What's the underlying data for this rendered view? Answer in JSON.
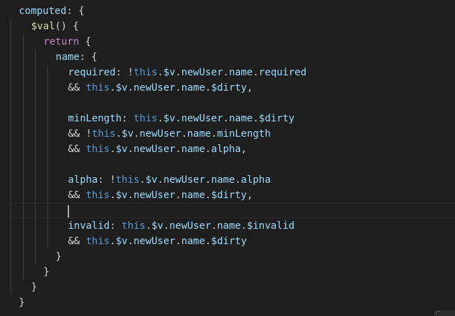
{
  "editor": {
    "lines": [
      [
        {
          "t": "computed",
          "c": "prop"
        },
        {
          "t": ": {",
          "c": "punc"
        }
      ],
      [
        {
          "t": "$val",
          "c": "func"
        },
        {
          "t": "() {",
          "c": "punc"
        }
      ],
      [
        {
          "t": "return",
          "c": "kw"
        },
        {
          "t": " {",
          "c": "punc"
        }
      ],
      [
        {
          "t": "name",
          "c": "prop"
        },
        {
          "t": ": {",
          "c": "punc"
        }
      ],
      [
        {
          "t": "required",
          "c": "prop"
        },
        {
          "t": ": !",
          "c": "punc"
        },
        {
          "t": "this",
          "c": "this"
        },
        {
          "t": ".",
          "c": "punc"
        },
        {
          "t": "$v",
          "c": "prop"
        },
        {
          "t": ".",
          "c": "punc"
        },
        {
          "t": "newUser",
          "c": "prop"
        },
        {
          "t": ".",
          "c": "punc"
        },
        {
          "t": "name",
          "c": "prop"
        },
        {
          "t": ".",
          "c": "punc"
        },
        {
          "t": "required",
          "c": "prop"
        }
      ],
      [
        {
          "t": "&& ",
          "c": "punc"
        },
        {
          "t": "this",
          "c": "this"
        },
        {
          "t": ".",
          "c": "punc"
        },
        {
          "t": "$v",
          "c": "prop"
        },
        {
          "t": ".",
          "c": "punc"
        },
        {
          "t": "newUser",
          "c": "prop"
        },
        {
          "t": ".",
          "c": "punc"
        },
        {
          "t": "name",
          "c": "prop"
        },
        {
          "t": ".",
          "c": "punc"
        },
        {
          "t": "$dirty",
          "c": "prop"
        },
        {
          "t": ",",
          "c": "punc"
        }
      ],
      [],
      [
        {
          "t": "minLength",
          "c": "prop"
        },
        {
          "t": ": ",
          "c": "punc"
        },
        {
          "t": "this",
          "c": "this"
        },
        {
          "t": ".",
          "c": "punc"
        },
        {
          "t": "$v",
          "c": "prop"
        },
        {
          "t": ".",
          "c": "punc"
        },
        {
          "t": "newUser",
          "c": "prop"
        },
        {
          "t": ".",
          "c": "punc"
        },
        {
          "t": "name",
          "c": "prop"
        },
        {
          "t": ".",
          "c": "punc"
        },
        {
          "t": "$dirty",
          "c": "prop"
        }
      ],
      [
        {
          "t": "&& !",
          "c": "punc"
        },
        {
          "t": "this",
          "c": "this"
        },
        {
          "t": ".",
          "c": "punc"
        },
        {
          "t": "$v",
          "c": "prop"
        },
        {
          "t": ".",
          "c": "punc"
        },
        {
          "t": "newUser",
          "c": "prop"
        },
        {
          "t": ".",
          "c": "punc"
        },
        {
          "t": "name",
          "c": "prop"
        },
        {
          "t": ".",
          "c": "punc"
        },
        {
          "t": "minLength",
          "c": "prop"
        }
      ],
      [
        {
          "t": "&& ",
          "c": "punc"
        },
        {
          "t": "this",
          "c": "this"
        },
        {
          "t": ".",
          "c": "punc"
        },
        {
          "t": "$v",
          "c": "prop"
        },
        {
          "t": ".",
          "c": "punc"
        },
        {
          "t": "newUser",
          "c": "prop"
        },
        {
          "t": ".",
          "c": "punc"
        },
        {
          "t": "name",
          "c": "prop"
        },
        {
          "t": ".",
          "c": "punc"
        },
        {
          "t": "alpha",
          "c": "prop"
        },
        {
          "t": ",",
          "c": "punc"
        }
      ],
      [],
      [
        {
          "t": "alpha",
          "c": "prop"
        },
        {
          "t": ": !",
          "c": "punc"
        },
        {
          "t": "this",
          "c": "this"
        },
        {
          "t": ".",
          "c": "punc"
        },
        {
          "t": "$v",
          "c": "prop"
        },
        {
          "t": ".",
          "c": "punc"
        },
        {
          "t": "newUser",
          "c": "prop"
        },
        {
          "t": ".",
          "c": "punc"
        },
        {
          "t": "name",
          "c": "prop"
        },
        {
          "t": ".",
          "c": "punc"
        },
        {
          "t": "alpha",
          "c": "prop"
        }
      ],
      [
        {
          "t": "&& ",
          "c": "punc"
        },
        {
          "t": "this",
          "c": "this"
        },
        {
          "t": ".",
          "c": "punc"
        },
        {
          "t": "$v",
          "c": "prop"
        },
        {
          "t": ".",
          "c": "punc"
        },
        {
          "t": "newUser",
          "c": "prop"
        },
        {
          "t": ".",
          "c": "punc"
        },
        {
          "t": "name",
          "c": "prop"
        },
        {
          "t": ".",
          "c": "punc"
        },
        {
          "t": "$dirty",
          "c": "prop"
        },
        {
          "t": ",",
          "c": "punc"
        }
      ],
      [],
      [
        {
          "t": "invalid",
          "c": "prop"
        },
        {
          "t": ": ",
          "c": "punc"
        },
        {
          "t": "this",
          "c": "this"
        },
        {
          "t": ".",
          "c": "punc"
        },
        {
          "t": "$v",
          "c": "prop"
        },
        {
          "t": ".",
          "c": "punc"
        },
        {
          "t": "newUser",
          "c": "prop"
        },
        {
          "t": ".",
          "c": "punc"
        },
        {
          "t": "name",
          "c": "prop"
        },
        {
          "t": ".",
          "c": "punc"
        },
        {
          "t": "$invalid",
          "c": "prop"
        }
      ],
      [
        {
          "t": "&& ",
          "c": "punc"
        },
        {
          "t": "this",
          "c": "this"
        },
        {
          "t": ".",
          "c": "punc"
        },
        {
          "t": "$v",
          "c": "prop"
        },
        {
          "t": ".",
          "c": "punc"
        },
        {
          "t": "newUser",
          "c": "prop"
        },
        {
          "t": ".",
          "c": "punc"
        },
        {
          "t": "name",
          "c": "prop"
        },
        {
          "t": ".",
          "c": "punc"
        },
        {
          "t": "$dirty",
          "c": "prop"
        }
      ],
      [
        {
          "t": "}",
          "c": "punc"
        }
      ],
      [
        {
          "t": "}",
          "c": "punc"
        }
      ],
      [
        {
          "t": "}",
          "c": "punc"
        }
      ],
      [
        {
          "t": "}",
          "c": "punc"
        }
      ]
    ],
    "indent_levels": [
      0,
      1,
      2,
      3,
      4,
      4,
      4,
      4,
      4,
      4,
      4,
      4,
      4,
      4,
      4,
      4,
      3,
      2,
      1,
      0
    ],
    "cursor_line": 13
  },
  "theme": {
    "background": "#1e1e1e",
    "property": "#9cdcfe",
    "function": "#dcdcaa",
    "keyword": "#c586c0",
    "this": "#569cd6",
    "punctuation": "#d4d4d4"
  }
}
